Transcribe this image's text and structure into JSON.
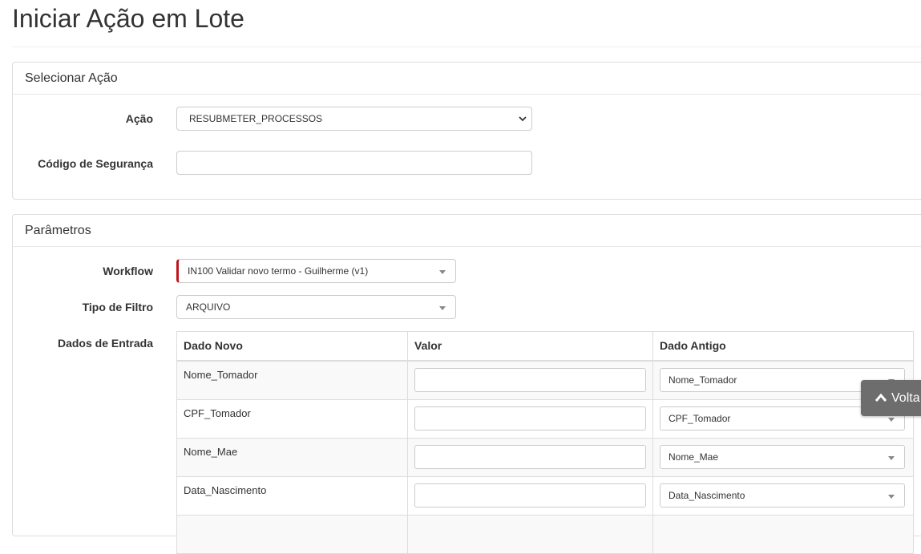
{
  "page": {
    "title": "Iniciar Ação em Lote"
  },
  "select_action_panel": {
    "heading": "Selecionar Ação",
    "action_label": "Ação",
    "action_value": "RESUBMETER_PROCESSOS",
    "security_code_label": "Código de Segurança",
    "security_code_value": ""
  },
  "parameters_panel": {
    "heading": "Parâmetros",
    "workflow_label": "Workflow",
    "workflow_value": "IN100 Validar novo termo - Guilherme (v1)",
    "filter_type_label": "Tipo de Filtro",
    "filter_type_value": "ARQUIVO",
    "input_data_label": "Dados de Entrada",
    "table": {
      "headers": [
        "Dado Novo",
        "Valor",
        "Dado Antigo"
      ],
      "rows": [
        {
          "new_field": "Nome_Tomador",
          "value": "",
          "old_field": "Nome_Tomador"
        },
        {
          "new_field": "CPF_Tomador",
          "value": "",
          "old_field": "CPF_Tomador"
        },
        {
          "new_field": "Nome_Mae",
          "value": "",
          "old_field": "Nome_Mae"
        },
        {
          "new_field": "Data_Nascimento",
          "value": "",
          "old_field": "Data_Nascimento"
        }
      ]
    }
  },
  "back_button": {
    "label": "Volta",
    "icon": "chevron-up-icon"
  },
  "colors": {
    "required_marker": "#c0141c",
    "back_button_bg": "#6d6d6d"
  }
}
